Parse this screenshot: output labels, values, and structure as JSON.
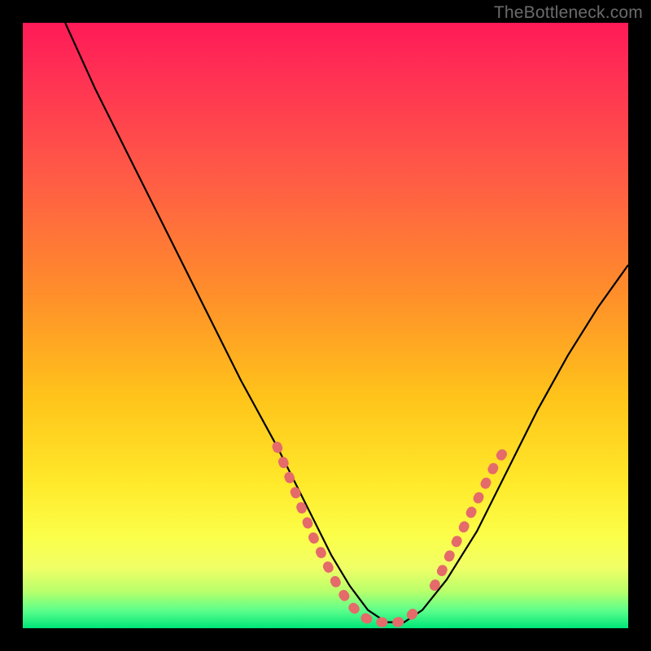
{
  "watermark": {
    "text": "TheBottleneck.com"
  },
  "gradient_colors": {
    "top": "#ff1a57",
    "mid1": "#ff8f2a",
    "mid2": "#ffe92a",
    "bottom": "#00e67a"
  },
  "chart_data": {
    "type": "line",
    "title": "",
    "xlabel": "",
    "ylabel": "",
    "xlim": [
      0,
      100
    ],
    "ylim": [
      0,
      100
    ],
    "note": "Axes are unlabeled in the source image. x/y values below are estimated relative percentages (0–100) of the plot area, y=0 at bottom, y=100 at top.",
    "series": [
      {
        "name": "main-curve",
        "color": "#000000",
        "x": [
          7,
          12,
          18,
          24,
          30,
          36,
          42,
          47,
          51,
          54,
          57,
          60,
          63,
          66,
          70,
          75,
          80,
          85,
          90,
          95,
          100
        ],
        "y": [
          100,
          89,
          77,
          65,
          53,
          41,
          30,
          20,
          12,
          7,
          3,
          1,
          1,
          3,
          8,
          16,
          26,
          36,
          45,
          53,
          60
        ]
      },
      {
        "name": "highlight-left-arm",
        "color": "#e56a6a",
        "x": [
          42,
          44,
          46,
          48,
          50,
          52,
          54,
          56,
          58,
          60,
          62,
          64,
          66
        ],
        "y": [
          30,
          25,
          20,
          15,
          11,
          7,
          4,
          2,
          1,
          1,
          1,
          2,
          4
        ]
      },
      {
        "name": "highlight-right-arm",
        "color": "#e56a6a",
        "x": [
          68,
          70,
          72,
          74,
          76,
          78,
          80
        ],
        "y": [
          7,
          11,
          15,
          19,
          23,
          27,
          30
        ]
      }
    ]
  }
}
